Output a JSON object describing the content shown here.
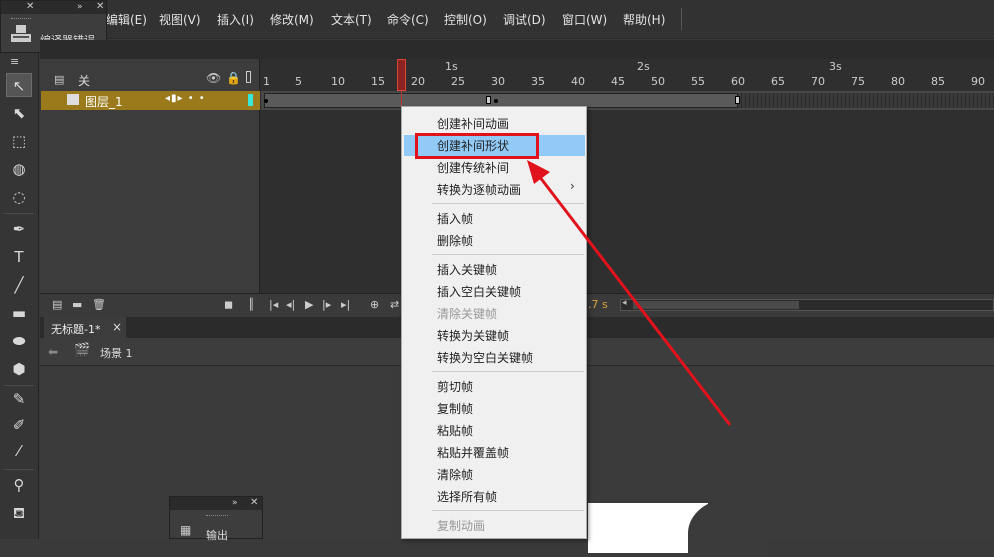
{
  "menubar": {
    "items": [
      "编辑(E)",
      "视图(V)",
      "插入(I)",
      "修改(M)",
      "文本(T)",
      "命令(C)",
      "控制(O)",
      "调试(D)",
      "窗口(W)",
      "帮助(H)"
    ]
  },
  "error_panel": {
    "label": "编译器错误",
    "close": "✕",
    "expand": "»",
    "close2": "✕"
  },
  "toolbar": {
    "menu_icon": "≡",
    "tools": [
      {
        "name": "selection-tool-icon",
        "glyph": "↖",
        "active": true
      },
      {
        "name": "subselection-tool-icon",
        "glyph": "⬉"
      },
      {
        "name": "free-transform-tool-icon",
        "glyph": "⬚"
      },
      {
        "name": "3d-rotation-tool-icon",
        "glyph": "◍"
      },
      {
        "name": "lasso-tool-icon",
        "glyph": "◌"
      },
      {
        "name": "pen-tool-icon",
        "glyph": "✒"
      },
      {
        "name": "text-tool-icon",
        "glyph": "T"
      },
      {
        "name": "line-tool-icon",
        "glyph": "╱"
      },
      {
        "name": "rectangle-tool-icon",
        "glyph": "▬"
      },
      {
        "name": "oval-tool-icon",
        "glyph": "⬬"
      },
      {
        "name": "polystar-tool-icon",
        "glyph": "⬢"
      },
      {
        "name": "pencil-tool-icon",
        "glyph": "✎"
      },
      {
        "name": "brush-tool-icon",
        "glyph": "✐"
      },
      {
        "name": "paint-brush-tool-icon",
        "glyph": "⁄"
      },
      {
        "name": "bone-tool-icon",
        "glyph": "⚲"
      },
      {
        "name": "paint-bucket-tool-icon",
        "glyph": "⛾"
      }
    ]
  },
  "timeline": {
    "layers_label": "关",
    "layer_name": "图层_1",
    "layer_controls": "◂▮▸ • •",
    "layer_color": "#39e8d8",
    "ruler_numbers": [
      "1",
      "5",
      "10",
      "15",
      "20",
      "25",
      "30",
      "35",
      "40",
      "45",
      "50",
      "55",
      "60",
      "65",
      "70",
      "75",
      "80",
      "85",
      "90"
    ],
    "ruler_seconds": [
      "1s",
      "2s",
      "3s"
    ],
    "fps_label": "2.7 s"
  },
  "document": {
    "tab_title": "无标题-1*",
    "tab_close": "×",
    "scene_label": "场景 1"
  },
  "output_panel": {
    "label": "输出",
    "expand": "»",
    "close": "✕"
  },
  "context_menu": {
    "items": [
      {
        "label": "创建补间动画"
      },
      {
        "label": "创建补间形状",
        "highlighted": true
      },
      {
        "label": "创建传统补间"
      },
      {
        "label": "转换为逐帧动画",
        "submenu": true
      },
      {
        "label": "插入帧"
      },
      {
        "label": "删除帧"
      },
      {
        "label": "插入关键帧"
      },
      {
        "label": "插入空白关键帧"
      },
      {
        "label": "清除关键帧",
        "disabled": true
      },
      {
        "label": "转换为关键帧"
      },
      {
        "label": "转换为空白关键帧"
      },
      {
        "label": "剪切帧"
      },
      {
        "label": "复制帧"
      },
      {
        "label": "粘贴帧"
      },
      {
        "label": "粘贴并覆盖帧"
      },
      {
        "label": "清除帧"
      },
      {
        "label": "选择所有帧"
      },
      {
        "label": "复制动画",
        "disabled": true
      }
    ],
    "submenu_arrow": "›"
  },
  "colors": {
    "highlight": "#91c9f7",
    "annotation_red": "#e0121b",
    "layer_bar": "#9a7a1a"
  }
}
